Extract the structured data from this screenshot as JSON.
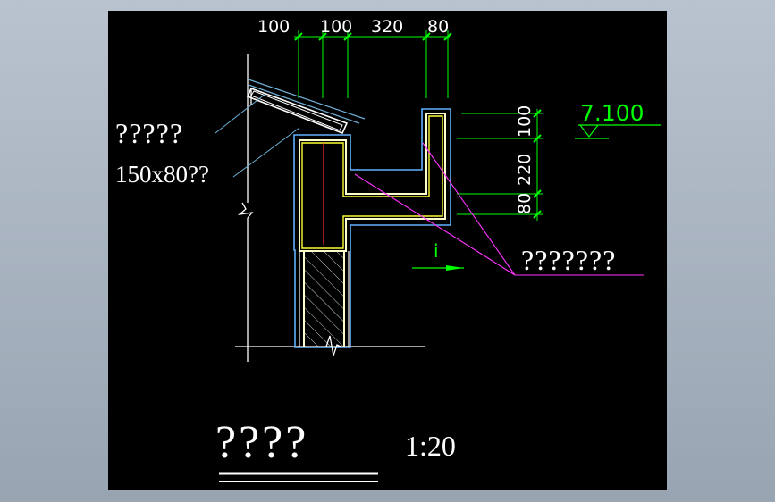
{
  "drawing": {
    "top_dimensions": [
      "100",
      "100",
      "320",
      "80"
    ],
    "right_dimensions": [
      "100",
      "220",
      "80"
    ],
    "elevation": "7.100",
    "label_tile": "?????",
    "label_member": "150x80??",
    "label_gutter": "???????",
    "section_mark": "i",
    "title": "????",
    "scale": "1:20"
  }
}
